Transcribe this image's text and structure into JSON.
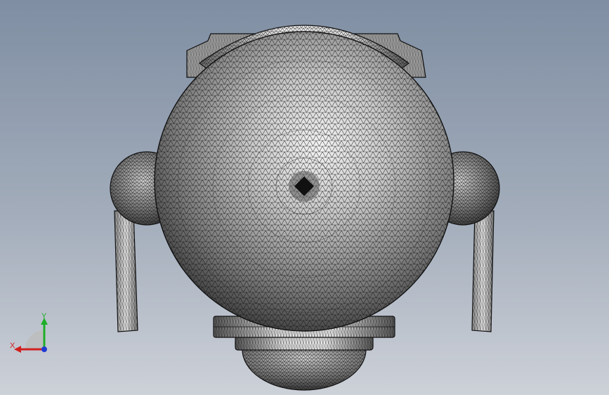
{
  "viewport": {
    "background_top": "#7f8ea3",
    "background_bottom": "#cdd1d8"
  },
  "model": {
    "description_icon": "wireframe-mesh-sphere-camera",
    "mesh_color": "#111111",
    "shade_light": "#e9e9e9",
    "shade_dark": "#4a4a4a"
  },
  "triad": {
    "x_label": "X",
    "y_label": "Y",
    "x_color": "#d21f1f",
    "y_color": "#1fae2a",
    "z_color": "#1f3ad2"
  }
}
